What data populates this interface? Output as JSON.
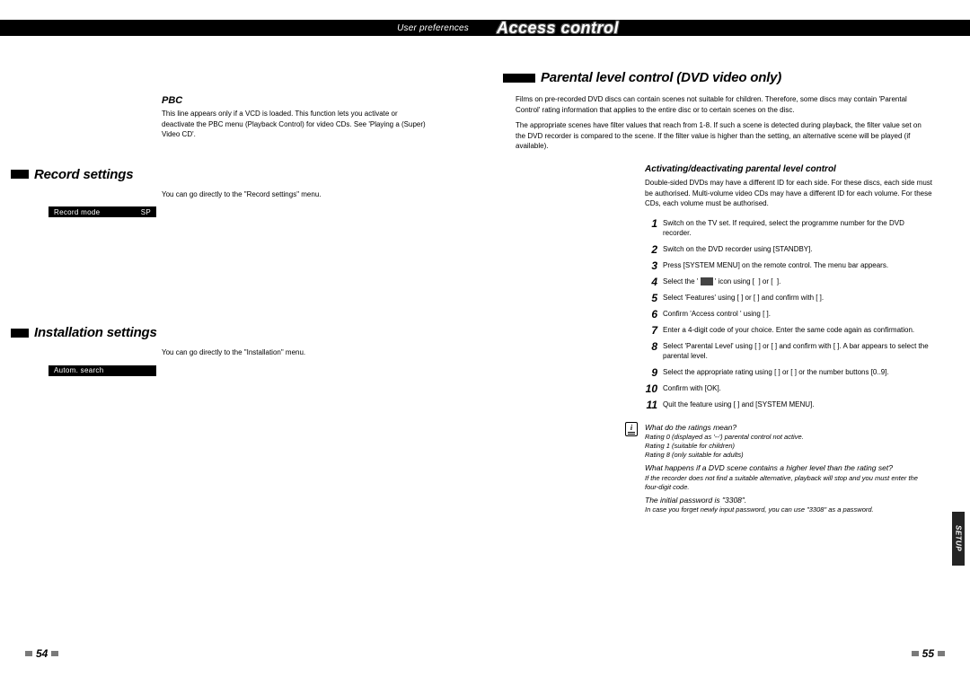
{
  "header": {
    "left_subtitle": "User preferences",
    "chapter_title": "Access control"
  },
  "left_page": {
    "pbc": {
      "heading": "PBC",
      "text": "This line appears only if a VCD is loaded. This function lets you activate or deactivate the PBC menu (Playback Control) for video CDs. See 'Playing a (Super) Video CD'."
    },
    "record": {
      "heading": "Record settings",
      "text": "You can go directly to the \"Record settings\" menu.",
      "row_label": "Record mode",
      "row_value": "SP"
    },
    "install": {
      "heading": "Installation settings",
      "text": "You can go directly to the \"Installation\" menu.",
      "row_label": "Autom. search",
      "row_value": ""
    },
    "page_num": "54"
  },
  "right_page": {
    "chapter_heading": "Parental level control (DVD video only)",
    "intro1": "Films on pre-recorded DVD discs can contain scenes not suitable for children. Therefore, some discs may contain 'Parental Control' rating information that applies to the entire disc or to certain scenes on the disc.",
    "intro2": "The appropriate scenes have filter values that reach from 1-8. If such a scene is detected during playback, the filter value set on the DVD recorder is compared to the scene. If the filter value is higher than the setting, an alternative scene will be played (if available).",
    "sub_heading": "Activating/deactivating parental level control",
    "sub_intro": "Double-sided DVDs may have a different ID for each side. For these discs, each side must be authorised. Multi-volume video CDs may have a different ID for each volume. For these CDs, each volume must be authorised.",
    "steps": [
      "Switch on the TV set. If required, select the programme number for the DVD recorder.",
      "Switch on the DVD recorder using [STANDBY].",
      "Press [SYSTEM MENU] on the remote control. The menu bar appears.",
      "Select the ' ▣ ' icon using [   ] or [   ].",
      "Select 'Features' using [   ] or [   ] and confirm with [   ].",
      "Confirm 'Access control ' using [   ].",
      "Enter a 4-digit code of your choice. Enter the same code again as confirmation.",
      "Select 'Parental Level' using [   ] or [   ] and confirm with [   ]. A bar appears to select the parental level.",
      "Select the appropriate rating using [   ] or [   ] or the number buttons [0..9].",
      "Confirm with [OK].",
      "Quit the feature using [   ] and [SYSTEM MENU]."
    ],
    "tips": {
      "q1": "What do the ratings mean?",
      "a1a": "Rating 0 (displayed as '--') parental control not active.",
      "a1b": "Rating 1 (suitable for children)",
      "a1c": "Rating 8 (only suitable for adults)",
      "q2": "What happens if a DVD scene contains a higher level than the rating set?",
      "a2": "If the recorder does not find a suitable alternative, playback will stop and you must enter the four-digit code.",
      "q3": "The initial password is \"3308\".",
      "a3": "In case you forget newly input password, you can use \"3308\" as a password."
    },
    "side_tab": "SETUP",
    "page_num": "55"
  }
}
